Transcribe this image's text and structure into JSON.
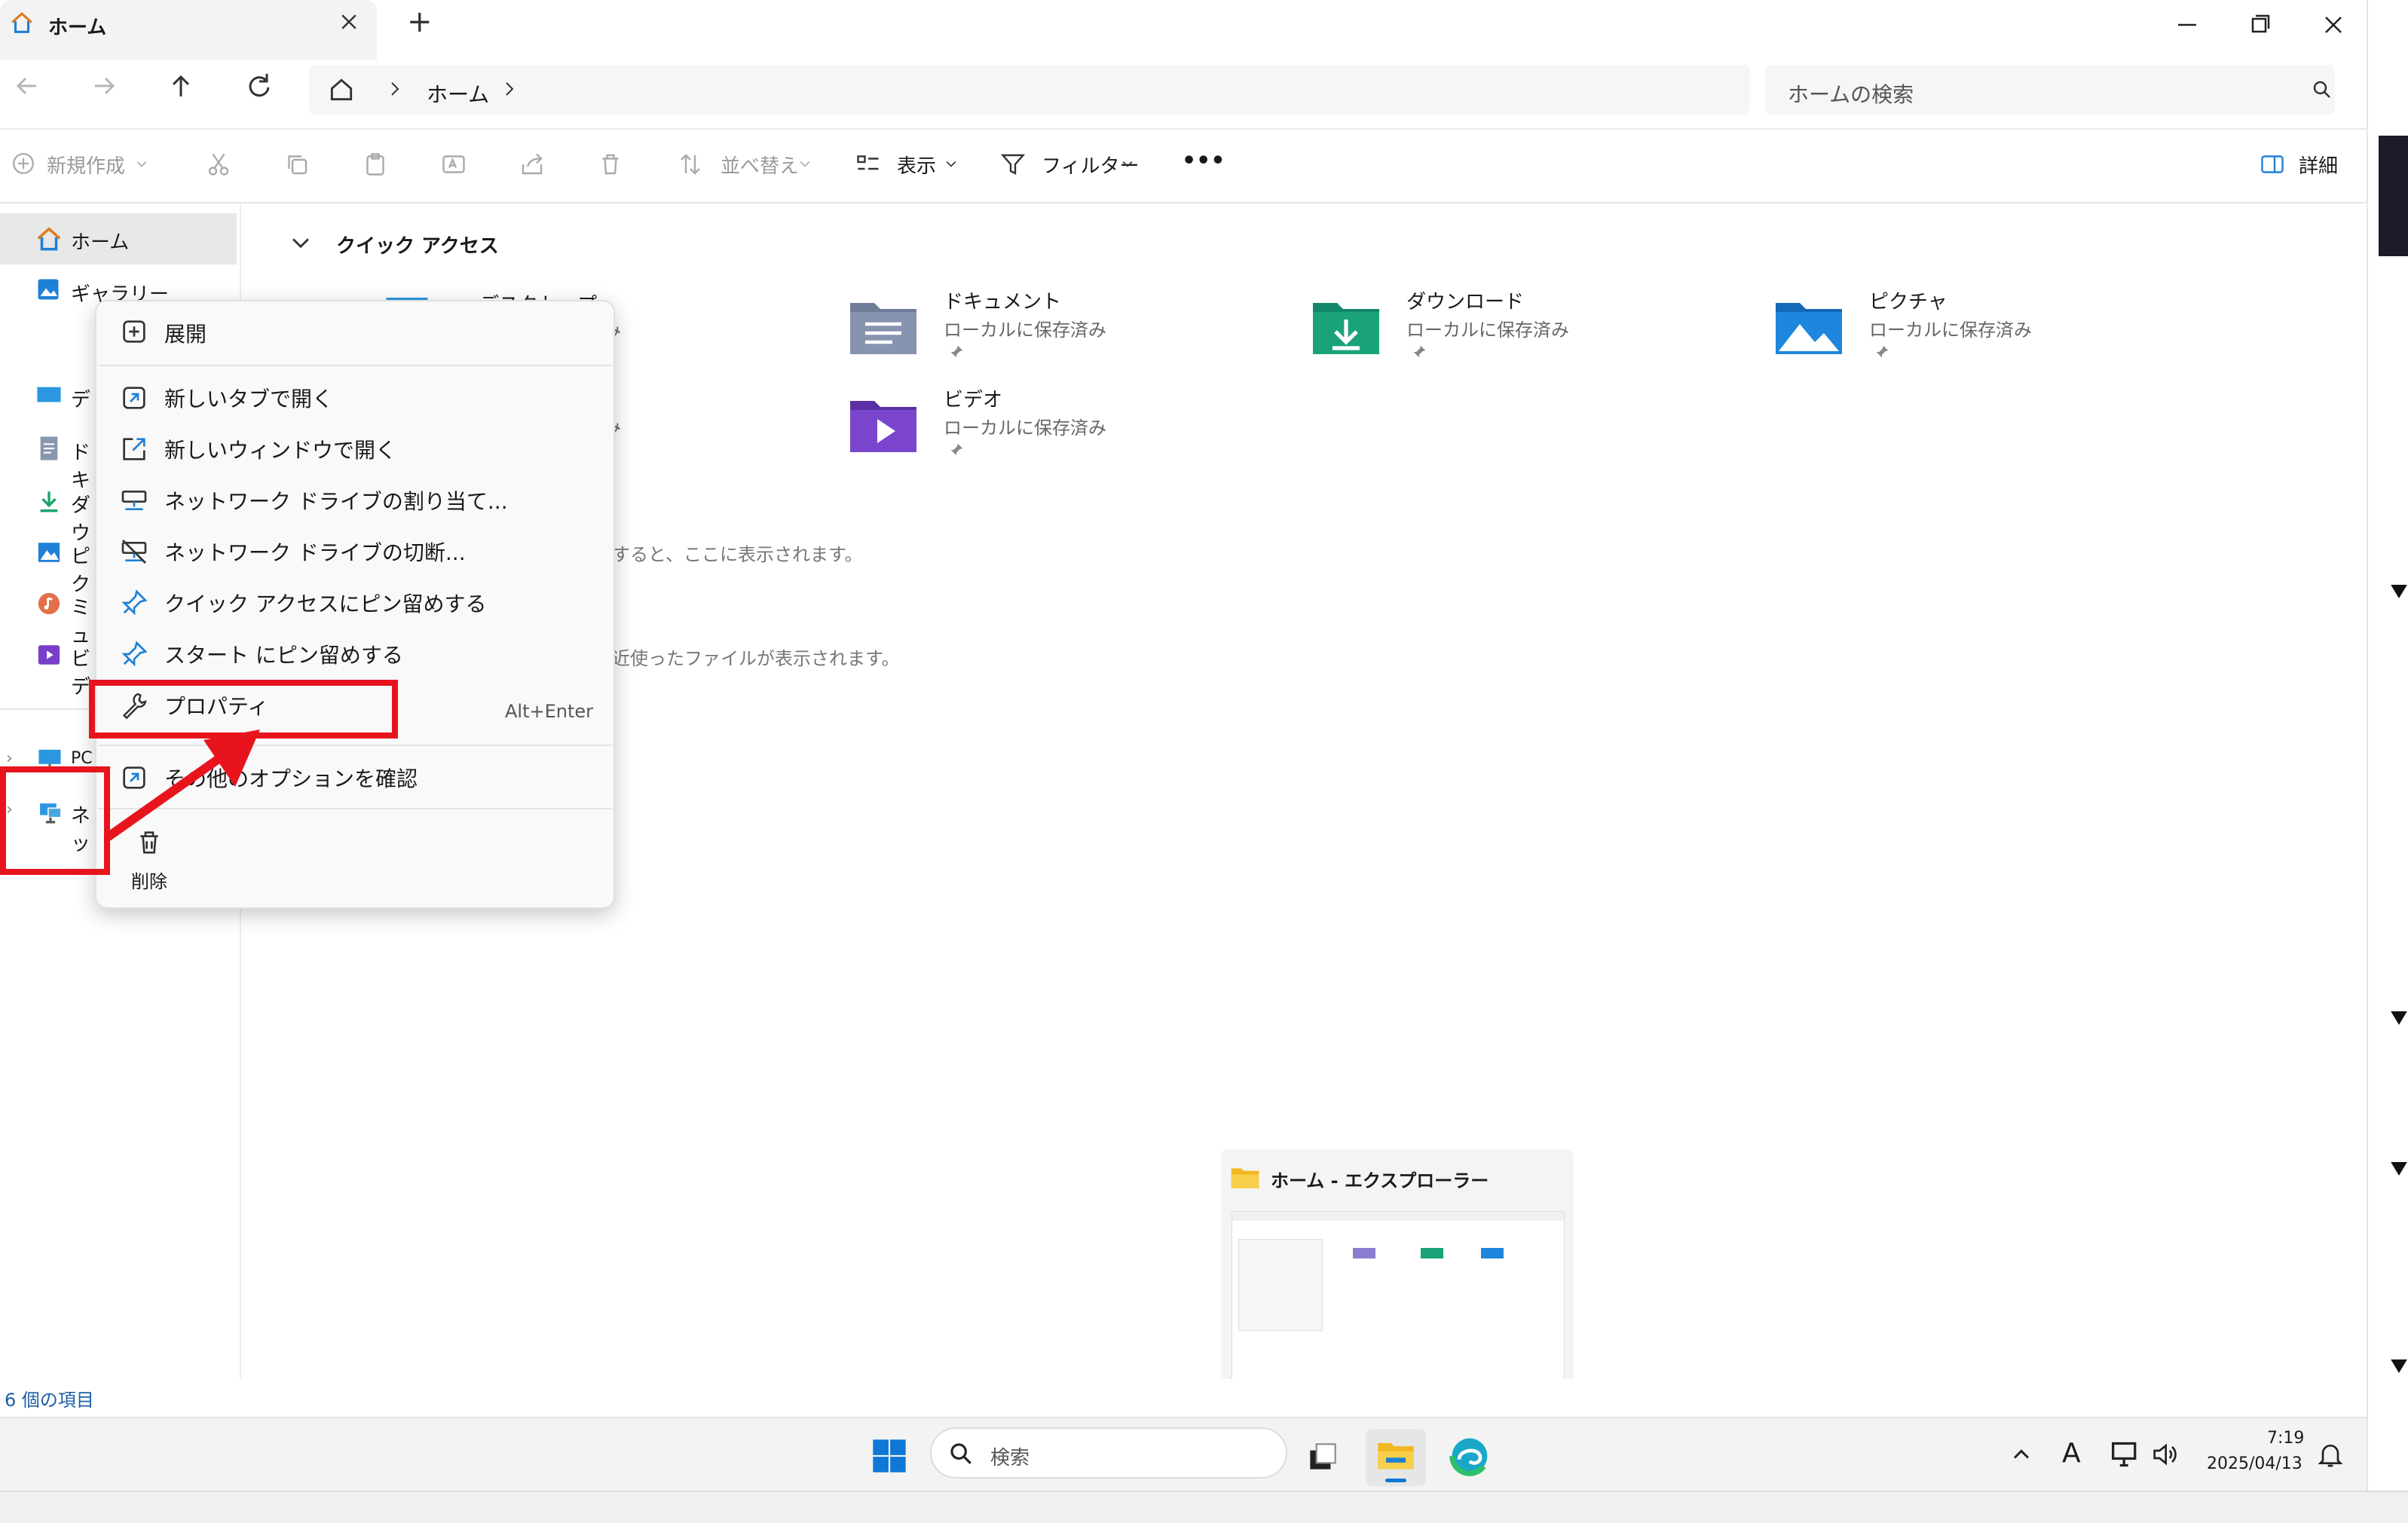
{
  "window": {
    "tab_title": "ホーム",
    "new_tab": "+",
    "icons": {
      "tab": "home-icon",
      "close": "close-icon",
      "minimize": "minimize-icon",
      "restore": "restore-icon"
    }
  },
  "address": {
    "crumb": "ホーム",
    "search_placeholder": "ホームの検索"
  },
  "commandbar": {
    "new": "新規作成",
    "sort": "並べ替え",
    "view": "表示",
    "filter": "フィルター",
    "more": "•••",
    "details": "詳細"
  },
  "sidebar": {
    "home": "ホーム",
    "gallery": "ギャラリー",
    "pinned": [
      {
        "label": "デ",
        "icon": "desktop-icon"
      },
      {
        "label": "ドキ",
        "icon": "documents-icon"
      },
      {
        "label": "ダウ",
        "icon": "download-icon"
      },
      {
        "label": "ピク",
        "icon": "pictures-icon"
      },
      {
        "label": "ミュ",
        "icon": "music-icon"
      },
      {
        "label": "ビデ",
        "icon": "videos-icon"
      }
    ],
    "pc": "PC",
    "network": "ネッ"
  },
  "main": {
    "section": "クイック アクセス",
    "folders": [
      {
        "name": "デスクトップ",
        "sub": "み"
      },
      {
        "name": "ドキュメント",
        "sub": "ローカルに保存済み"
      },
      {
        "name": "ダウンロード",
        "sub": "ローカルに保存済み"
      },
      {
        "name": "ピクチャ",
        "sub": "ローカルに保存済み"
      },
      {
        "name": "ビデオ",
        "sub": "ローカルに保存済み"
      }
    ],
    "second_sub": "み",
    "favorites_hint": "すると、ここに表示されます。",
    "recent_hint": "近使ったファイルが表示されます。"
  },
  "context_menu": {
    "expand": "展開",
    "open_new_tab": "新しいタブで開く",
    "open_new_window": "新しいウィンドウで開く",
    "map_drive": "ネットワーク ドライブの割り当て...",
    "disconnect_drive": "ネットワーク ドライブの切断...",
    "pin_quick_access": "クイック アクセスにピン留めする",
    "pin_start": "スタート にピン留めする",
    "properties": "プロパティ",
    "properties_shortcut": "Alt+Enter",
    "more_options": "その他のオプションを確認",
    "delete": "削除"
  },
  "thumbnail": {
    "title": "ホーム - エクスプローラー"
  },
  "status": {
    "count": "6 個の項目"
  },
  "taskbar": {
    "search": "検索",
    "ime": "A",
    "time": "7:19",
    "date": "2025/04/13"
  },
  "colors": {
    "accent_red": "#e8141d",
    "selection": "#e8e8e8",
    "folder_blue": "#1a86d9"
  }
}
